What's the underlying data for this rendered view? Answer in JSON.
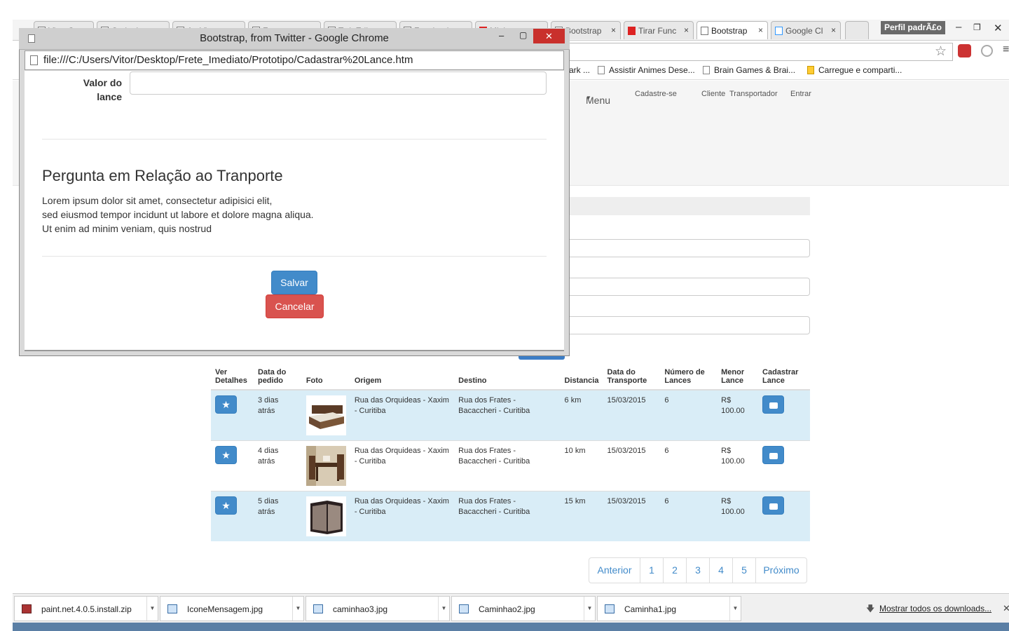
{
  "browser": {
    "tabs": [
      {
        "label": "Vitor Gomes",
        "icon": "facebook-icon"
      },
      {
        "label": "Outlook.com",
        "icon": "outlook-icon"
      },
      {
        "label": "Ao Vivo",
        "icon": "facebook-icon"
      },
      {
        "label": "Frete",
        "icon": "page-icon"
      },
      {
        "label": "Twit Editor",
        "icon": "page-icon"
      },
      {
        "label": "Facebook",
        "icon": "facebook-icon"
      },
      {
        "label": "Minha conta",
        "icon": "youtube-icon"
      },
      {
        "label": "Bootstrap",
        "icon": "page-icon"
      },
      {
        "label": "Tirar Func",
        "icon": "youtube-icon"
      },
      {
        "label": "Bootstrap",
        "icon": "page-icon",
        "active": true
      },
      {
        "label": "Google Cl",
        "icon": "google-icon"
      }
    ],
    "profile": "Perfil padrÃ£o",
    "bookmarks": [
      "ark ...",
      "Assistir Animes Dese...",
      "Brain Games & Brai...",
      "Carregue e comparti..."
    ]
  },
  "navbar": {
    "menu": "Menu",
    "links": [
      "Cadastre-se",
      "Cliente",
      "Transportador",
      "Entrar"
    ]
  },
  "table": {
    "headers": [
      "Ver Detalhes",
      "Data do pedido",
      "Foto",
      "Origem",
      "Destino",
      "Distancia",
      "Data do Transporte",
      "Número de Lances",
      "Menor Lance",
      "Cadastrar Lance"
    ],
    "rows": [
      {
        "data_pedido": "3 dias atrás",
        "foto": "bed",
        "origem": "Rua das Orquideas - Xaxim - Curitiba",
        "destino": "Rua dos Frates - Bacaccheri - Curitiba",
        "distancia": "6 km",
        "data_transporte": "15/03/2015",
        "lances": "6",
        "menor_lance": "R$ 100.00"
      },
      {
        "data_pedido": "4 dias atrás",
        "foto": "table",
        "origem": "Rua das Orquideas - Xaxim - Curitiba",
        "destino": "Rua dos Frates - Bacaccheri - Curitiba",
        "distancia": "10 km",
        "data_transporte": "15/03/2015",
        "lances": "6",
        "menor_lance": "R$ 100.00"
      },
      {
        "data_pedido": "5 dias atrás",
        "foto": "cabinet",
        "origem": "Rua das Orquideas - Xaxim - Curitiba",
        "destino": "Rua dos Frates - Bacaccheri - Curitiba",
        "distancia": "15 km",
        "data_transporte": "15/03/2015",
        "lances": "6",
        "menor_lance": "R$ 100.00"
      }
    ]
  },
  "pagination": {
    "prev": "Anterior",
    "pages": [
      "1",
      "2",
      "3",
      "4",
      "5"
    ],
    "next": "Próximo"
  },
  "downloads": {
    "items": [
      "paint.net.4.0.5.install.zip",
      "IconeMensagem.jpg",
      "caminhao3.jpg",
      "Caminhao2.jpg",
      "Caminha1.jpg"
    ],
    "show_all": "Mostrar todos os downloads..."
  },
  "popup": {
    "title": "Bootstrap, from Twitter - Google Chrome",
    "url": "file:///C:/Users/Vitor/Desktop/Frete_Imediato/Prototipo/Cadastrar%20Lance.htm",
    "valor_label": "Valor do lance",
    "valor_value": "",
    "heading": "Pergunta em Relação ao Tranporte",
    "paragraph_lines": [
      "Lorem ipsum dolor sit amet, consectetur adipisici elit,",
      "sed eiusmod tempor incidunt ut labore et dolore magna aliqua.",
      "Ut enim ad minim veniam, quis nostrud"
    ],
    "save": "Salvar",
    "cancel": "Cancelar"
  },
  "colors": {
    "primary": "#428bca",
    "danger": "#d9534f",
    "row_info": "#d9edf7",
    "close_red": "#c9302c"
  }
}
